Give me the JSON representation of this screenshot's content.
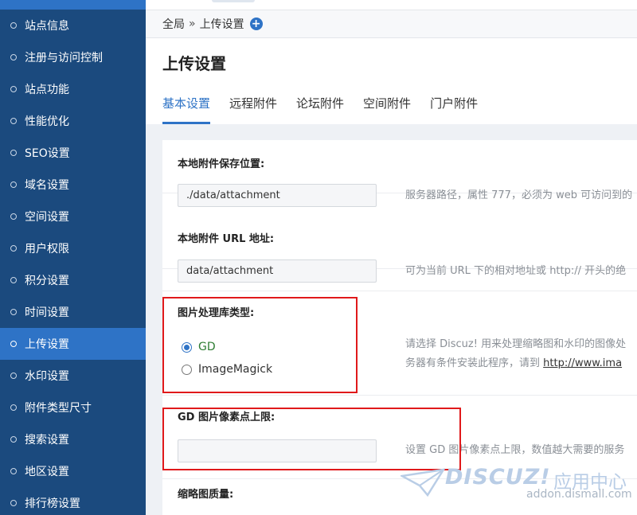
{
  "sidebar": {
    "items": [
      {
        "label": "站点信息",
        "active": false
      },
      {
        "label": "注册与访问控制",
        "active": false
      },
      {
        "label": "站点功能",
        "active": false
      },
      {
        "label": "性能优化",
        "active": false
      },
      {
        "label": "SEO设置",
        "active": false
      },
      {
        "label": "域名设置",
        "active": false
      },
      {
        "label": "空间设置",
        "active": false
      },
      {
        "label": "用户权限",
        "active": false
      },
      {
        "label": "积分设置",
        "active": false
      },
      {
        "label": "时间设置",
        "active": false
      },
      {
        "label": "上传设置",
        "active": true
      },
      {
        "label": "水印设置",
        "active": false
      },
      {
        "label": "附件类型尺寸",
        "active": false
      },
      {
        "label": "搜索设置",
        "active": false
      },
      {
        "label": "地区设置",
        "active": false
      },
      {
        "label": "排行榜设置",
        "active": false
      }
    ]
  },
  "breadcrumb": {
    "root": "全局",
    "separator": "»",
    "current": "上传设置"
  },
  "page": {
    "title": "上传设置"
  },
  "tabs": [
    {
      "label": "基本设置",
      "active": true
    },
    {
      "label": "远程附件",
      "active": false
    },
    {
      "label": "论坛附件",
      "active": false
    },
    {
      "label": "空间附件",
      "active": false
    },
    {
      "label": "门户附件",
      "active": false
    }
  ],
  "settings": {
    "local_path": {
      "label": "本地附件保存位置:",
      "value": "./data/attachment",
      "hint": "服务器路径，属性 777，必须为 web 可访问到的"
    },
    "local_url": {
      "label": "本地附件 URL 地址:",
      "value": "data/attachment",
      "hint": "可为当前 URL 下的相对地址或 http:// 开头的绝"
    },
    "image_lib": {
      "label": "图片处理库类型:",
      "options": [
        "GD",
        "ImageMagick"
      ],
      "selected": "GD",
      "hint_line1": "请选择 Discuz! 用来处理缩略图和水印的图像处",
      "hint_line2_prefix": "务器有条件安装此程序，请到 ",
      "hint_link": "http://www.ima"
    },
    "gd_limit": {
      "label": "GD 图片像素点上限:",
      "value": "",
      "hint": "设置 GD 图片像素点上限，数值越大需要的服务"
    },
    "thumb_quality": {
      "label": "缩略图质量:"
    }
  },
  "watermark": {
    "logo_text": "DISCUZ!",
    "cn_text": "应用中心",
    "url": "addon.dismall.com"
  },
  "colors": {
    "sidebar_bg": "#1b4a7e",
    "accent": "#2e73c6",
    "highlight": "#e0191b"
  }
}
